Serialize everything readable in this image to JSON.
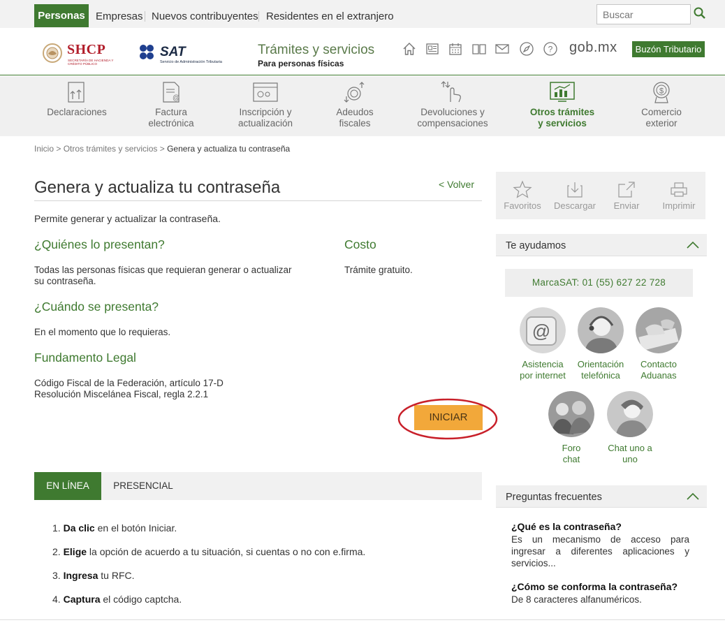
{
  "topbar": {
    "personas": "Personas",
    "empresas": "Empresas",
    "nuevos": "Nuevos contribuyentes",
    "residentes": "Residentes en el extranjero",
    "search_placeholder": "Buscar"
  },
  "header": {
    "shcp": "SHCP",
    "shcp_sub": "SECRETARÍA DE HACIENDA Y CRÉDITO PÚBLICO",
    "sat": "SAT",
    "sat_sub": "Servicio de Administración Tributaria",
    "tramites_title": "Trámites y servicios",
    "tramites_sub": "Para personas físicas",
    "gobmx": "gob.mx",
    "buzon": "Buzón Tributario",
    "icons": [
      "home-icon",
      "newspaper-icon",
      "calendar-icon",
      "book-icon",
      "mail-icon",
      "compass-icon",
      "help-icon"
    ]
  },
  "nav": [
    {
      "l1": "Declaraciones",
      "l2": ""
    },
    {
      "l1": "Factura",
      "l2": "electrónica"
    },
    {
      "l1": "Inscripción y",
      "l2": "actualización"
    },
    {
      "l1": "Adeudos",
      "l2": "fiscales"
    },
    {
      "l1": "Devoluciones y",
      "l2": "compensaciones"
    },
    {
      "l1": "Otros trámites",
      "l2": "y servicios"
    },
    {
      "l1": "Comercio",
      "l2": "exterior"
    }
  ],
  "breadcrumb": {
    "inicio": "Inicio",
    "sep": " > ",
    "otros": "Otros trámites y servicios",
    "current": "Genera y actualiza tu contraseña"
  },
  "main": {
    "title": "Genera y actualiza tu contraseña",
    "volver": "< Volver",
    "lead": "Permite generar y actualizar la contraseña.",
    "quienes_h": "¿Quiénes lo presentan?",
    "quienes_l1": "Todas las personas físicas  que  requieran generar o actualizar",
    "quienes_l2": "su contraseña.",
    "costo_h": "Costo",
    "costo_t": "Trámite gratuito.",
    "cuando_h": "¿Cuándo se presenta?",
    "cuando_t": "En el momento que lo requieras.",
    "fund_h": "Fundamento Legal",
    "fund_l1": "Código Fiscal de la Federación, artículo 17-D",
    "fund_l2": "Resolución Miscelánea Fiscal, regla 2.2.1",
    "iniciar": "INICIAR"
  },
  "tabs": {
    "online": "EN LÍNEA",
    "presencial": "PRESENCIAL"
  },
  "steps": [
    {
      "n": "1.",
      "b": "Da clic",
      "t": " en el botón Iniciar."
    },
    {
      "n": "2.",
      "b": "Elige",
      "t": " la opción de acuerdo a tu situación, si cuentas o no con e.firma."
    },
    {
      "n": "3.",
      "b": "Ingresa",
      "t": " tu RFC."
    },
    {
      "n": "4.",
      "b": "Captura",
      "t": " el código captcha."
    }
  ],
  "actions": {
    "favoritos": "Favoritos",
    "descargar": "Descargar",
    "enviar": "Enviar",
    "imprimir": "Imprimir"
  },
  "ayuda": {
    "title": "Te ayudamos",
    "marcasat": "MarcaSAT: 01 (55) 627 22 728",
    "items": [
      {
        "l1": "Asistencia",
        "l2": "por internet"
      },
      {
        "l1": "Orientación",
        "l2": "telefónica"
      },
      {
        "l1": "Contacto",
        "l2": "Aduanas"
      },
      {
        "l1": "Foro",
        "l2": "chat"
      },
      {
        "l1": "Chat uno a",
        "l2": "uno"
      }
    ]
  },
  "faq": {
    "title": "Preguntas frecuentes",
    "q1": "¿Qué es la contraseña?",
    "a1": "Es un mecanismo de acceso para ingresar a diferentes aplicaciones y servicios...",
    "q2": "¿Cómo se conforma la contraseña?",
    "a2": "De 8 caracteres alfanuméricos."
  },
  "colors": {
    "brand_green": "#3f7a30",
    "button_orange": "#f2a83a",
    "highlight_red": "#c8202a"
  }
}
